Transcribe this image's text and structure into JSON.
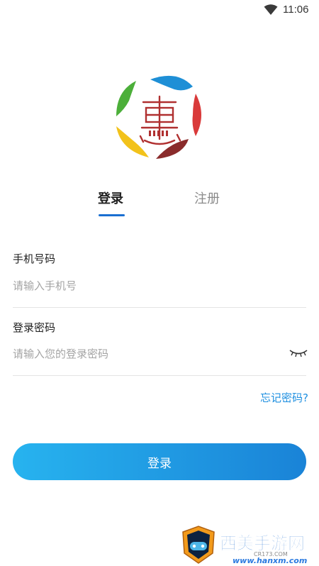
{
  "status_bar": {
    "time": "11:06",
    "icon": "wifi-icon"
  },
  "logo": {
    "icon": "brand-logo-icon",
    "colors": [
      "#1e8fd6",
      "#d93a3a",
      "#f2c21b",
      "#4caf3a",
      "#8a2b2b"
    ]
  },
  "tabs": [
    {
      "label": "登录",
      "active": true
    },
    {
      "label": "注册",
      "active": false
    }
  ],
  "form": {
    "phone": {
      "label": "手机号码",
      "placeholder": "请输入手机号",
      "value": ""
    },
    "password": {
      "label": "登录密码",
      "placeholder": "请输入您的登录密码",
      "value": "",
      "toggle_icon": "eye-closed-icon"
    },
    "forgot_label": "忘记密码?"
  },
  "submit": {
    "label": "登录"
  },
  "watermark": {
    "title": "西美手游网",
    "url": "www.hanxm.com",
    "small": "CR173.COM"
  },
  "colors": {
    "accent": "#1a6fd1",
    "link": "#1e8fe0",
    "button_start": "#27b3ef",
    "button_end": "#1a83d7"
  }
}
